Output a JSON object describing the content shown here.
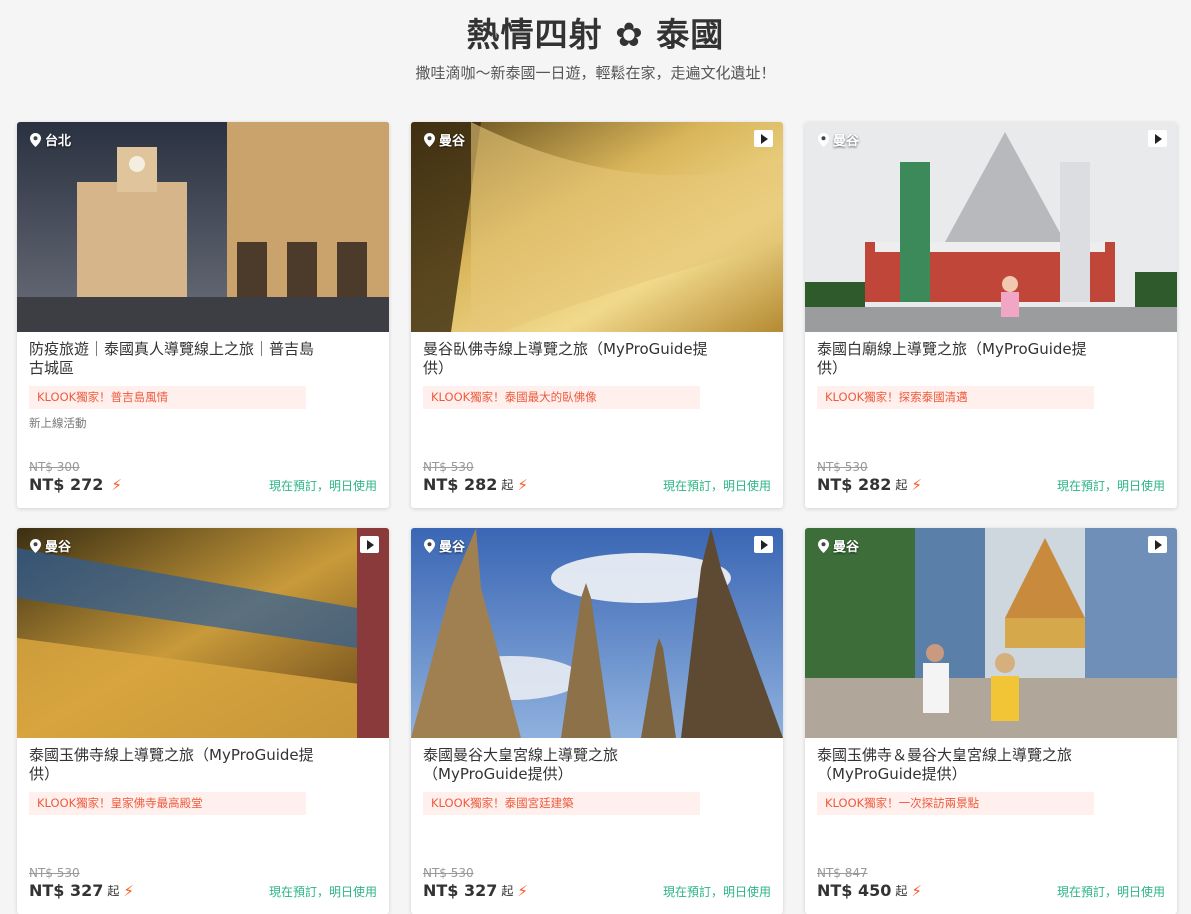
{
  "header": {
    "title": "熱情四射 ✿ 泰國",
    "subtitle": "撒哇滴咖～新泰國一日遊，輕鬆在家，走遍文化遺址！"
  },
  "cards": [
    {
      "location": "台北",
      "title": "防疫旅遊｜泰國真人導覽線上之旅｜普吉島古城區",
      "tag": "KLOOK獨家！普吉島風情",
      "extra": "新上線活動",
      "old_price": "NT$ 300",
      "price": "NT$ 272",
      "suffix": "",
      "booking": "現在預訂，明日使用",
      "video": false
    },
    {
      "location": "曼谷",
      "title": "曼谷臥佛寺線上導覽之旅（MyProGuide提供）",
      "tag": "KLOOK獨家！泰國最大的臥佛像",
      "extra": "",
      "old_price": "NT$ 530",
      "price": "NT$ 282",
      "suffix": "起",
      "booking": "現在預訂，明日使用",
      "video": true
    },
    {
      "location": "曼谷",
      "title": "泰國白廟線上導覽之旅（MyProGuide提供）",
      "tag": "KLOOK獨家！探索泰國清邁",
      "extra": "",
      "old_price": "NT$ 530",
      "price": "NT$ 282",
      "suffix": "起",
      "booking": "現在預訂，明日使用",
      "video": true
    },
    {
      "location": "曼谷",
      "title": "泰國玉佛寺線上導覽之旅（MyProGuide提供）",
      "tag": "KLOOK獨家！皇家佛寺最高殿堂",
      "extra": "",
      "old_price": "NT$ 530",
      "price": "NT$ 327",
      "suffix": "起",
      "booking": "現在預訂，明日使用",
      "video": true
    },
    {
      "location": "曼谷",
      "title": "泰國曼谷大皇宮線上導覽之旅（MyProGuide提供）",
      "tag": "KLOOK獨家！泰國宮廷建築",
      "extra": "",
      "old_price": "NT$ 530",
      "price": "NT$ 327",
      "suffix": "起",
      "booking": "現在預訂，明日使用",
      "video": true
    },
    {
      "location": "曼谷",
      "title": "泰國玉佛寺＆曼谷大皇宮線上導覽之旅（MyProGuide提供）",
      "tag": "KLOOK獨家！一次探訪兩景點",
      "extra": "",
      "old_price": "NT$ 847",
      "price": "NT$ 450",
      "suffix": "起",
      "booking": "現在預訂，明日使用",
      "video": true
    }
  ]
}
